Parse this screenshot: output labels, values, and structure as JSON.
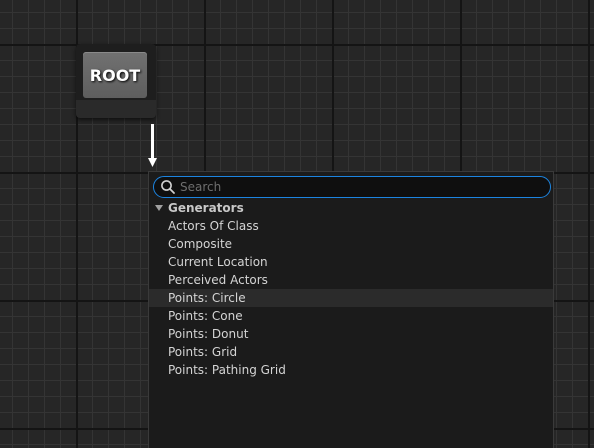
{
  "root_node": {
    "label": "ROOT"
  },
  "search": {
    "placeholder": "Search",
    "value": ""
  },
  "category": {
    "label": "Generators",
    "expanded": true
  },
  "items": [
    {
      "label": "Actors Of Class"
    },
    {
      "label": "Composite"
    },
    {
      "label": "Current Location"
    },
    {
      "label": "Perceived Actors"
    },
    {
      "label": "Points: Circle",
      "hovered": true
    },
    {
      "label": "Points: Cone"
    },
    {
      "label": "Points: Donut"
    },
    {
      "label": "Points: Grid"
    },
    {
      "label": "Points: Pathing Grid"
    }
  ],
  "colors": {
    "graph_background": "#262626",
    "search_focus_border": "#1c84e0",
    "node_title": "#6a6a6a",
    "wire": "#ffffff"
  },
  "icons": {
    "search": "search-icon",
    "category_toggle": "triangle-down-icon"
  }
}
